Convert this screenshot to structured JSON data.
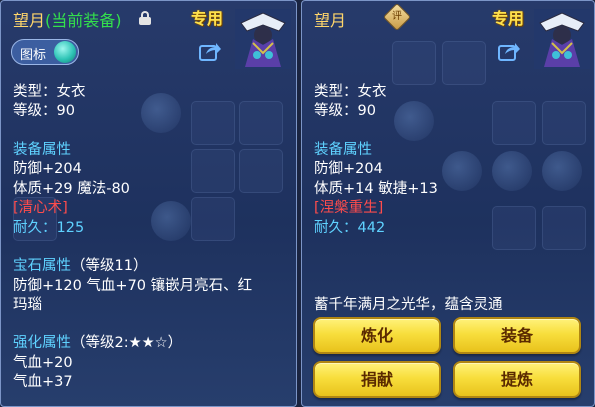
{
  "left": {
    "title": "望月",
    "equipped_tag": "(当前装备)",
    "exclusive": "专用",
    "icon_toggle_label": "图标",
    "type_line": "类型：女衣",
    "level_line": "等级：90",
    "equip_attr_header": "装备属性",
    "defense": "防御+204",
    "attrs": "体质+29 魔法-80",
    "special_skill": "[清心术]",
    "durability_label": "耐久：",
    "durability_value": "125",
    "gem_header": "宝石属性",
    "gem_level": "（等级11）",
    "gem_line1": "防御+120 气血+70 镶嵌月亮石、红",
    "gem_line2": "玛瑙",
    "enhance_header": "强化属性",
    "enhance_level": "（等级2:★★☆）",
    "hp1": "气血+20",
    "hp2": "气血+37"
  },
  "right": {
    "title": "望月",
    "appraise_badge": "评",
    "exclusive": "专用",
    "type_line": "类型：女衣",
    "level_line": "等级：90",
    "equip_attr_header": "装备属性",
    "defense": "防御+204",
    "attrs": "体质+14 敏捷+13",
    "special_skill": "[涅槃重生]",
    "durability_label": "耐久：",
    "durability_value": "442",
    "description": "蓄千年满月之光华，蕴含灵通",
    "buttons": {
      "refine": "炼化",
      "equip": "装备",
      "donate": "捐献",
      "extract": "提炼"
    }
  }
}
